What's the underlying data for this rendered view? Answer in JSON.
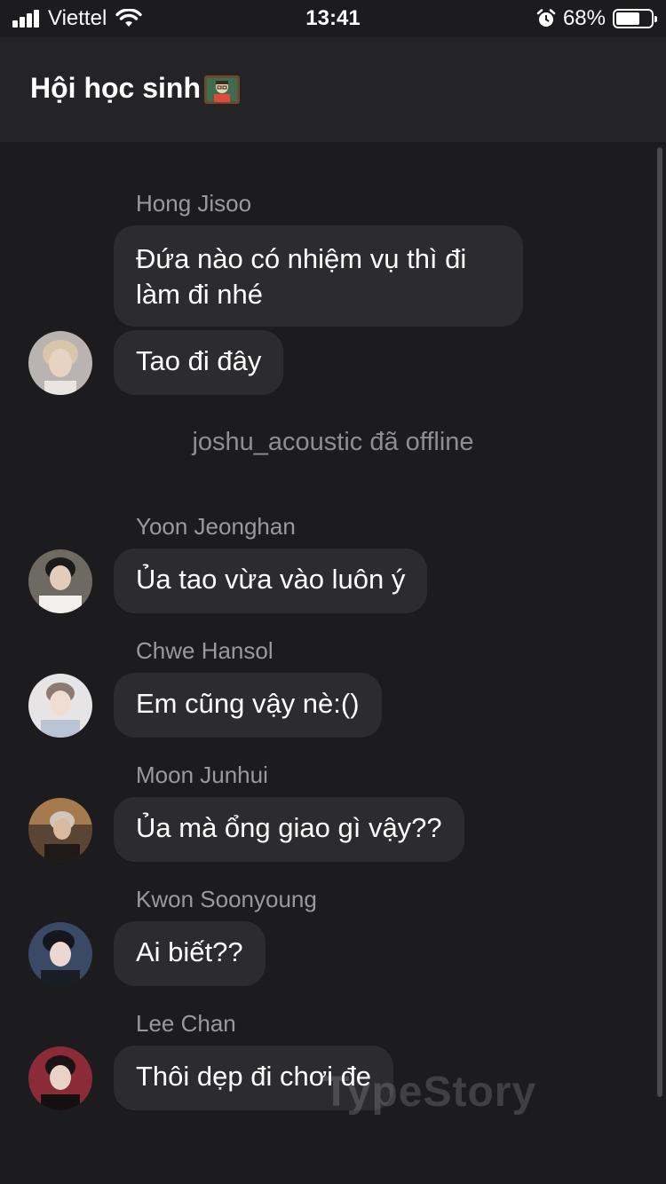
{
  "status_bar": {
    "carrier": "Viettel",
    "time": "13:41",
    "battery": "68%",
    "battery_level": 0.68
  },
  "header": {
    "title": "Hội học sinh"
  },
  "messages": [
    {
      "sender": "Hong Jisoo",
      "bubbles": [
        "Đứa nào có nhiệm vụ thì đi làm đi nhé",
        "Tao đi đây"
      ]
    },
    {
      "system": "joshu_acoustic đã offline"
    },
    {
      "sender": "Yoon Jeonghan",
      "bubbles": [
        "Ủa tao vừa vào luôn ý"
      ]
    },
    {
      "sender": "Chwe Hansol",
      "bubbles": [
        "Em cũng vậy nè:()"
      ]
    },
    {
      "sender": "Moon Junhui",
      "bubbles": [
        "Ủa mà ổng giao gì vậy??"
      ]
    },
    {
      "sender": "Kwon Soonyoung",
      "bubbles": [
        "Ai biết??"
      ]
    },
    {
      "sender": "Lee Chan",
      "bubbles": [
        "Thôi dẹp đi chơi đe"
      ]
    }
  ],
  "watermark": "TypeStory"
}
